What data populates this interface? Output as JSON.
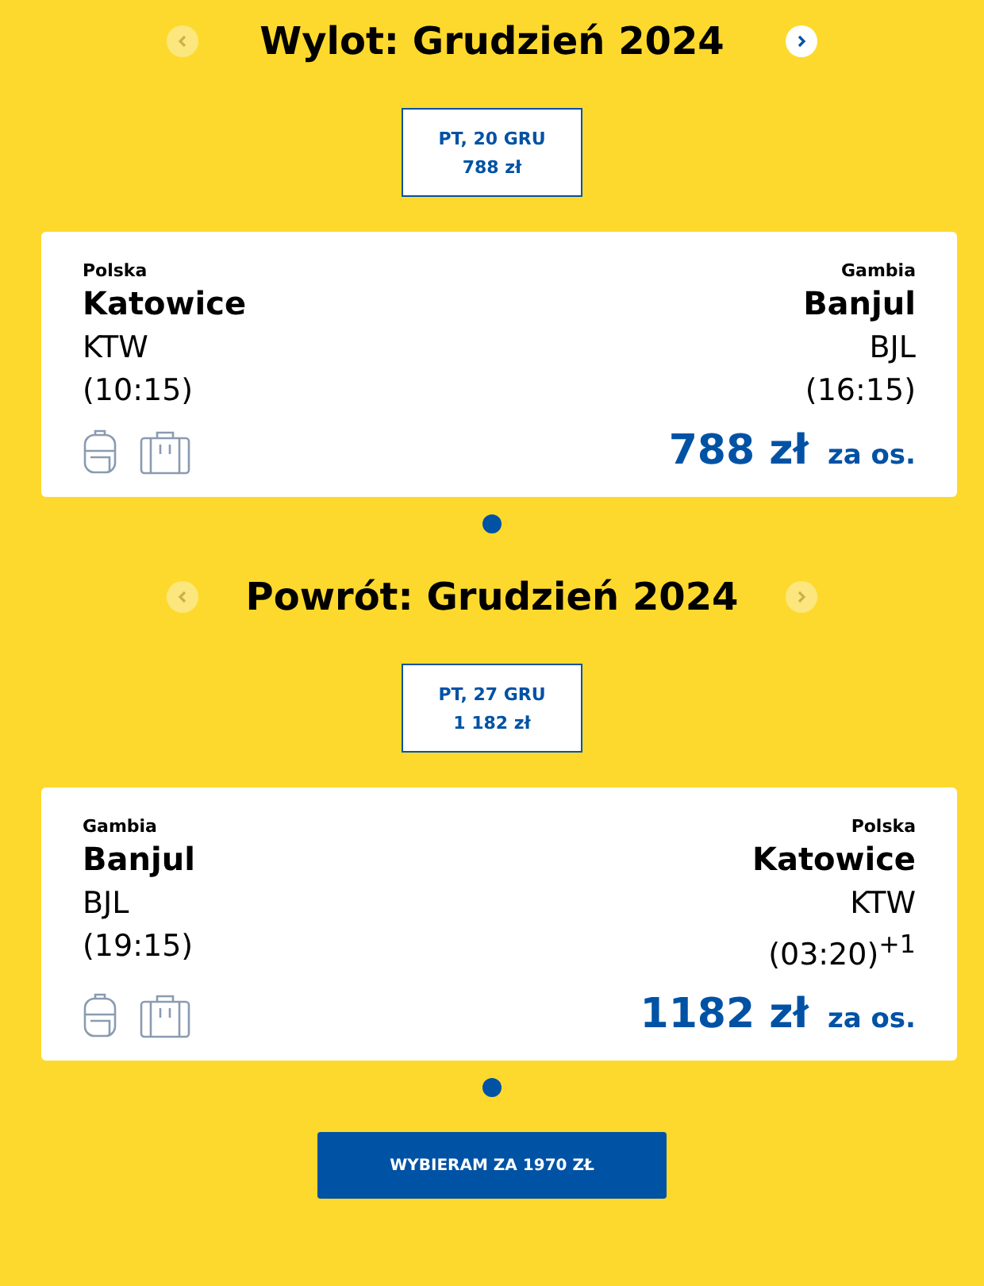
{
  "sections": [
    {
      "title": "Wylot: Grudzień 2024",
      "prev_disabled": true,
      "next_disabled": false,
      "dates": [
        {
          "day": "PT, 20 GRU",
          "price": "788 zł",
          "selected": true
        }
      ],
      "flight": {
        "from": {
          "country": "Polska",
          "city": "Katowice",
          "code": "KTW",
          "time": "(10:15)"
        },
        "to": {
          "country": "Gambia",
          "city": "Banjul",
          "code": "BJL",
          "time": "(16:15)"
        },
        "price": "788 zł",
        "per": "za os."
      },
      "pager": [
        {
          "selected": true
        }
      ]
    },
    {
      "title": "Powrót: Grudzień 2024",
      "prev_disabled": true,
      "next_disabled": true,
      "dates": [
        {
          "day": "PT, 27 GRU",
          "price": "1 182 zł",
          "selected": true
        }
      ],
      "flight": {
        "from": {
          "country": "Gambia",
          "city": "Banjul",
          "code": "BJL",
          "time": "(19:15)"
        },
        "to": {
          "country": "Polska",
          "city": "Katowice",
          "code": "KTW",
          "time": "(03:20)$^{+1}$"
        },
        "price": "1182 zł",
        "per": "za os."
      },
      "pager": [
        {
          "selected": true
        }
      ]
    }
  ],
  "button": "WYBIERAM ZA 1970 ZŁ"
}
